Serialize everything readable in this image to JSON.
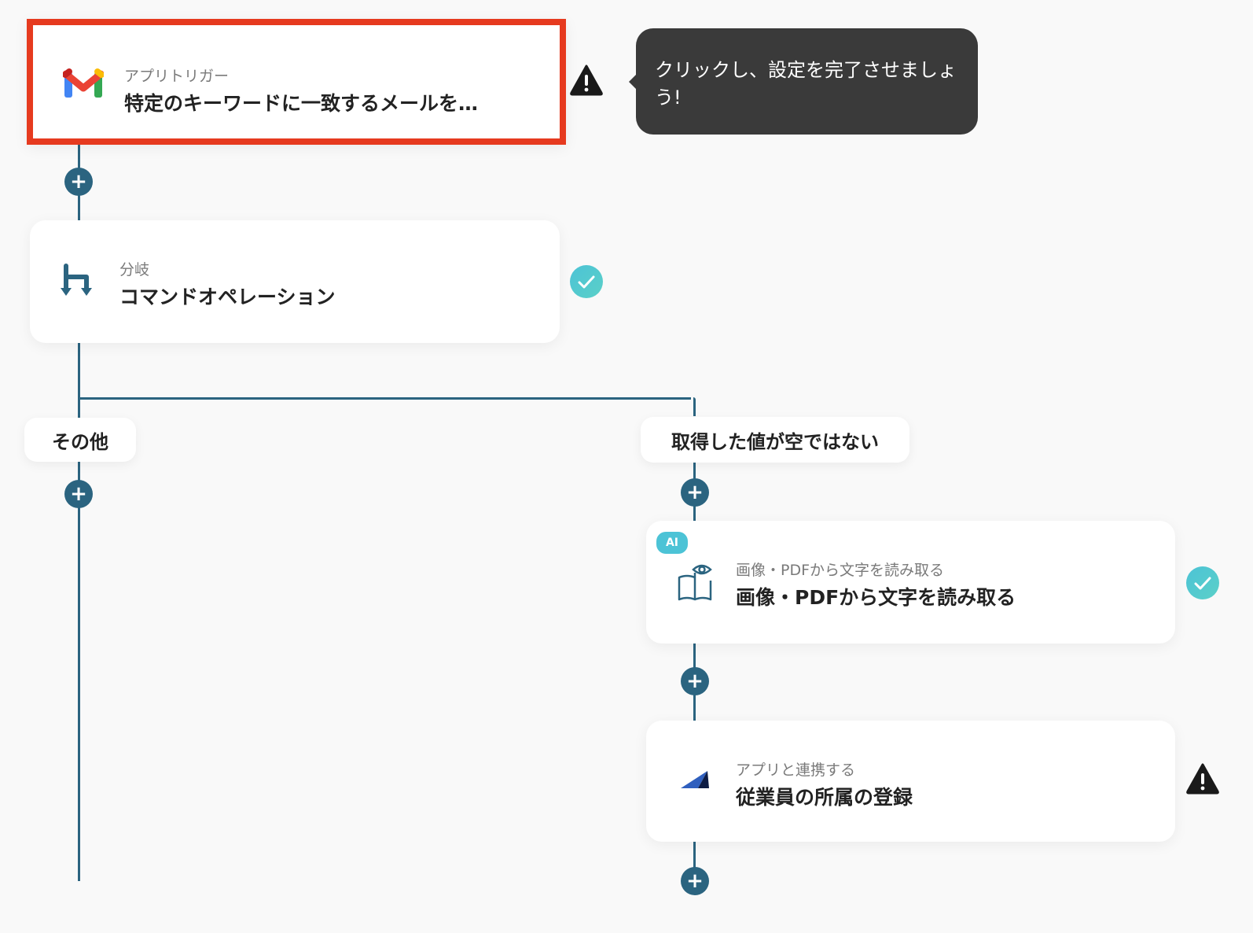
{
  "tooltip": {
    "text": "クリックし、設定を完了させましょう!"
  },
  "nodes": [
    {
      "subtitle": "アプリトリガー",
      "title": "特定のキーワードに一致するメールを…",
      "status": "warning"
    },
    {
      "subtitle": "分岐",
      "title": "コマンドオペレーション",
      "status": "complete"
    },
    {
      "badge": "AI",
      "subtitle": "画像・PDFから文字を読み取る",
      "title": "画像・PDFから文字を読み取る",
      "status": "complete"
    },
    {
      "subtitle": "アプリと連携する",
      "title": "従業員の所属の登録",
      "status": "warning"
    }
  ],
  "branches": {
    "left": "その他",
    "right": "取得した値が空ではない"
  },
  "colors": {
    "flow_line": "#2b6480",
    "selection_border": "#e63a1f",
    "tooltip_bg": "#3a3a3a",
    "check_gradient": [
      "#4cc3d6",
      "#5bd0c8"
    ],
    "ai_badge": "#4cc3d6"
  }
}
